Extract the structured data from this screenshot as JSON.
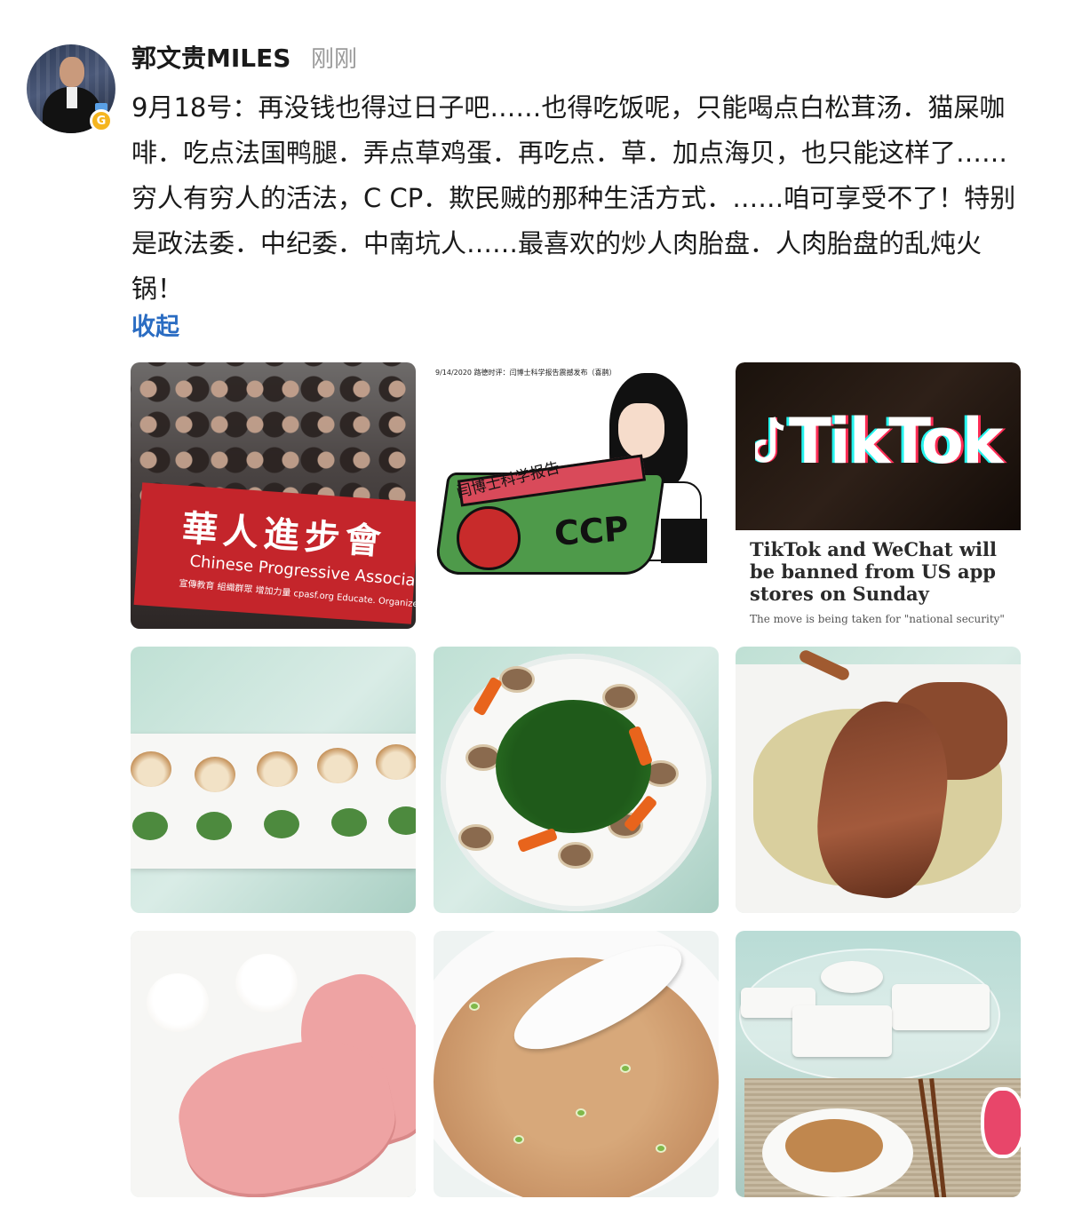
{
  "post": {
    "author": "郭文贵MILES",
    "time": "刚刚",
    "badge_letter": "G",
    "text": "9月18号：再没钱也得过日子吧……也得吃饭呢，只能喝点白松茸汤．猫屎咖啡．吃点法国鸭腿．弄点草鸡蛋．再吃点．草．加点海贝，也只能这样了……穷人有穷人的活法，C CP．欺民贼的那种生活方式．……咱可享受不了！特别是政法委．中纪委．中南坑人……最喜欢的炒人肉胎盘．人肉胎盘的乱炖火锅！",
    "collapse_label": "收起"
  },
  "images": {
    "protest": {
      "banner_cn": "華人進步會",
      "banner_en": "Chinese Progressive Association",
      "banner_small": "宣傳教育  組織群眾  增加力量   cpasf.org   Educate. Organize. Empower."
    },
    "cartoon": {
      "header": "9/14/2020 路德时评：闫博士科学报告震撼发布（喜鹊）",
      "label": "闫博士科学报告",
      "coffin_text": "CCP"
    },
    "tiktok": {
      "logo": "TikTok",
      "headline": "TikTok and WeChat will be banned from US app stores on Sunday",
      "sub": "The move is being taken for \"national security\""
    }
  },
  "colors": {
    "link": "#2a6cc2",
    "time": "#9a9a9a",
    "badge": "#f5b51f"
  }
}
